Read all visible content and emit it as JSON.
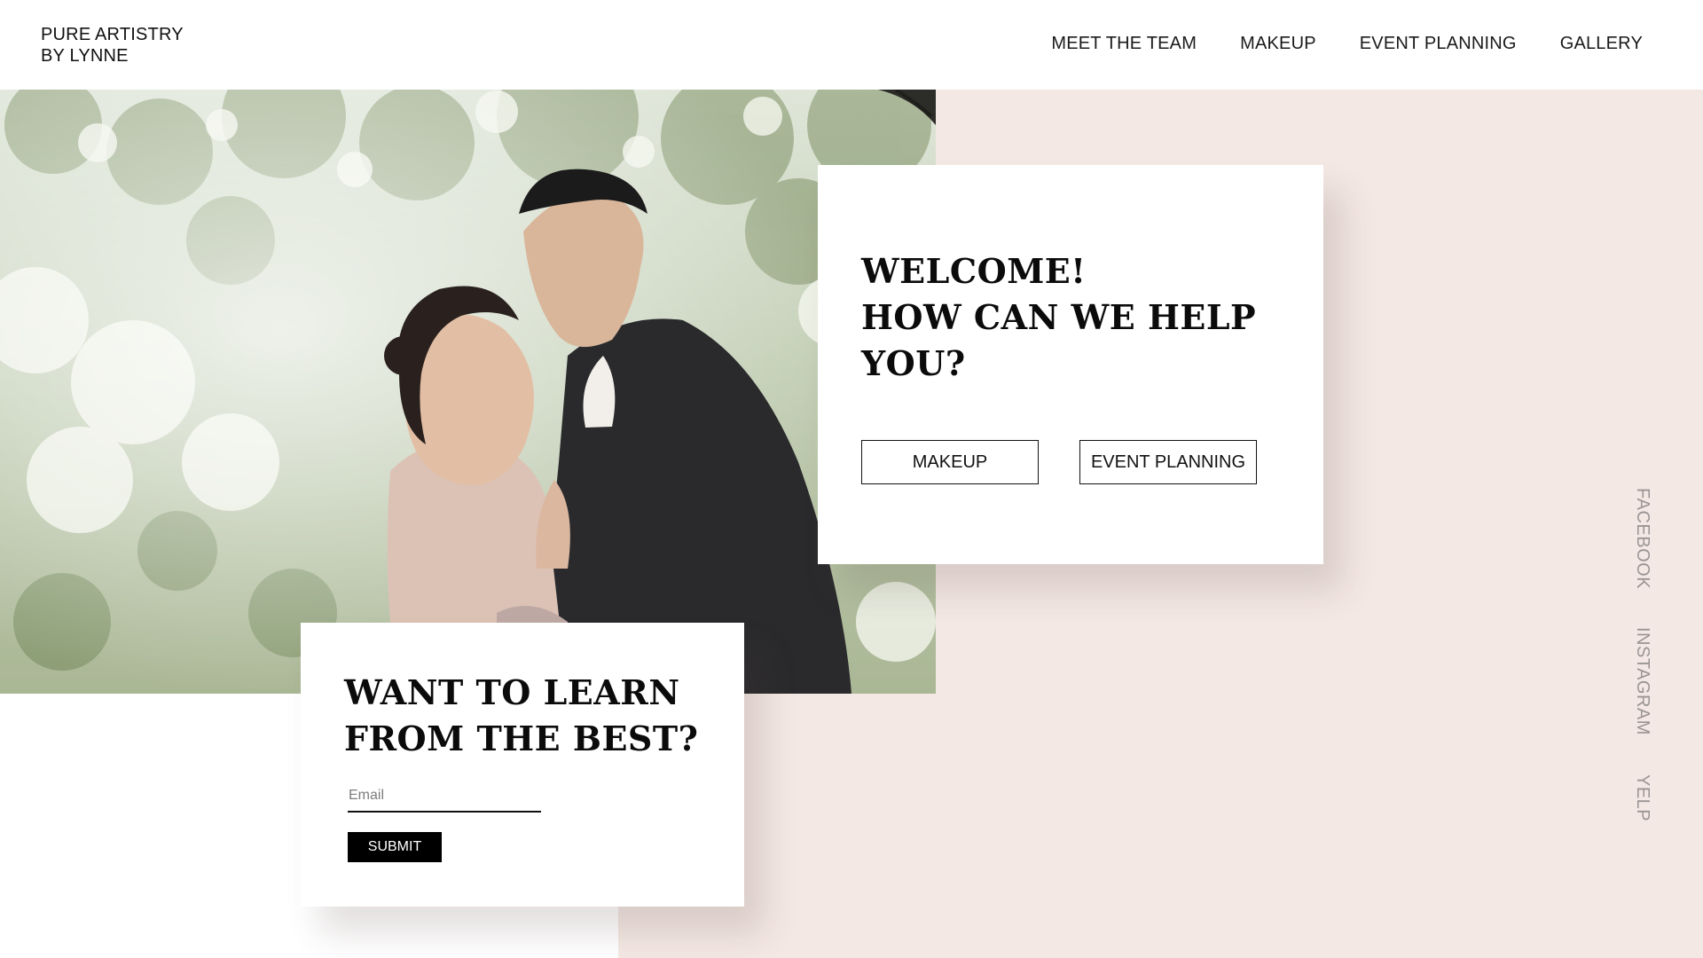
{
  "brand": {
    "line1": "PURE ARTISTRY",
    "line2": "BY LYNNE"
  },
  "nav": {
    "items": [
      {
        "label": "MEET THE TEAM"
      },
      {
        "label": "MAKEUP"
      },
      {
        "label": "EVENT PLANNING"
      },
      {
        "label": "GALLERY"
      }
    ]
  },
  "hero": {
    "image_alt": "couple-photo"
  },
  "welcome": {
    "title_line1": "WELCOME!",
    "title_line2": "HOW CAN WE HELP",
    "title_line3": "YOU?",
    "makeup_label": "MAKEUP",
    "event_label": "EVENT PLANNING"
  },
  "learn": {
    "title_line1": "WANT TO LEARN",
    "title_line2": "FROM THE BEST?",
    "email_placeholder": "Email",
    "submit_label": "SUBMIT"
  },
  "social": {
    "facebook": "FACEBOOK",
    "instagram": "INSTAGRAM",
    "yelp": "YELP"
  },
  "colors": {
    "pink_background": "#f4e8e4",
    "text": "#111111",
    "social_text": "#9a9594",
    "submit_bg": "#000000"
  }
}
